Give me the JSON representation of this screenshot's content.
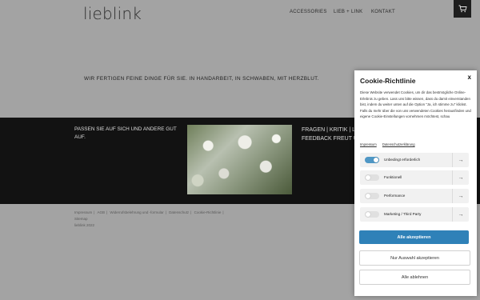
{
  "header": {
    "logo": "lieblink",
    "nav": [
      "ACCESSORIES",
      "LIEB + LINK",
      "KONTAKT"
    ],
    "cart_icon": "cart-icon"
  },
  "hero": {
    "tagline": "WIR FERTIGEN FEINE DINGE FÜR SIE. IN HANDARBEIT, IN SCHWABEN, MIT HERZBLUT."
  },
  "band": {
    "left_text": "PASSEN SIE AUF SICH UND ANDERE GUT AUF.",
    "right_text_line1": "FRAGEN | KRITIK | L",
    "right_text_line2": "FEEDBACK FREUT U"
  },
  "footer": {
    "links": [
      "Impressum",
      "AGB",
      "Widerrufsbelehrung und -formular",
      "Datenschutz",
      "Cookie-Richtlinie"
    ],
    "line2": "Sitemap",
    "line3": "lieblink 2022"
  },
  "cookie": {
    "title": "Cookie-Richtlinie",
    "close": "x",
    "body": "Diese Website verwendet Cookies, um dir das bestmögliche Online-Erlebnis zu geben. Lass uns bitte wissen, dass du damit einverstanden bist, indem du weiter unten auf die Option \"Ja, ich stimme zu\" klickst. Falls du mehr über die von uns verwendeten Cookies herausfinden und eigene Cookie-Einstellungen vornehmen möchtest, schau",
    "link_impressum": "Impressum",
    "link_privacy": "Datenschutzerklärung",
    "options": [
      {
        "label": "Unbedingt erforderlich",
        "on": true
      },
      {
        "label": "Funktionell",
        "on": false
      },
      {
        "label": "Performance",
        "on": false
      },
      {
        "label": "Marketing / Third Party",
        "on": false
      }
    ],
    "btn_accept_all": "Alle akzeptieren",
    "btn_accept_selected": "Nur Auswahl akzeptieren",
    "btn_decline_all": "Alle ablehnen",
    "accent_color": "#2f81b8"
  }
}
